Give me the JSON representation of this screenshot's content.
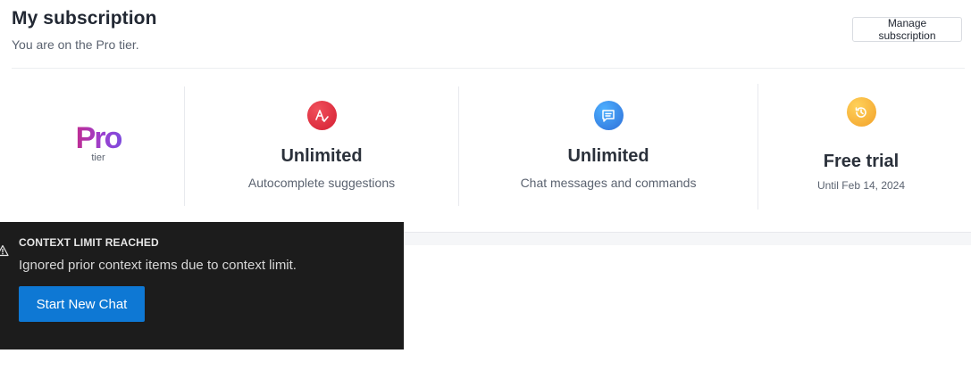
{
  "header": {
    "title": "My subscription",
    "subtitle": "You are on the Pro tier.",
    "manage_label": "Manage subscription"
  },
  "tier": {
    "name": "Pro",
    "label": "tier"
  },
  "stats": [
    {
      "icon": "spellcheck-icon",
      "color": "#e5303c",
      "value": "Unlimited",
      "description": "Autocomplete suggestions"
    },
    {
      "icon": "chat-message-icon",
      "color": "#3f86e6",
      "value": "Unlimited",
      "description": "Chat messages and commands"
    },
    {
      "icon": "history-clock-icon",
      "color": "#f2a932",
      "value": "Free trial",
      "description": "Until Feb 14, 2024"
    }
  ],
  "toast": {
    "icon": "warning-icon",
    "title": "CONTEXT LIMIT REACHED",
    "message": "Ignored prior context items due to context limit.",
    "button_label": "Start New Chat",
    "button_color": "#0e78d4"
  }
}
